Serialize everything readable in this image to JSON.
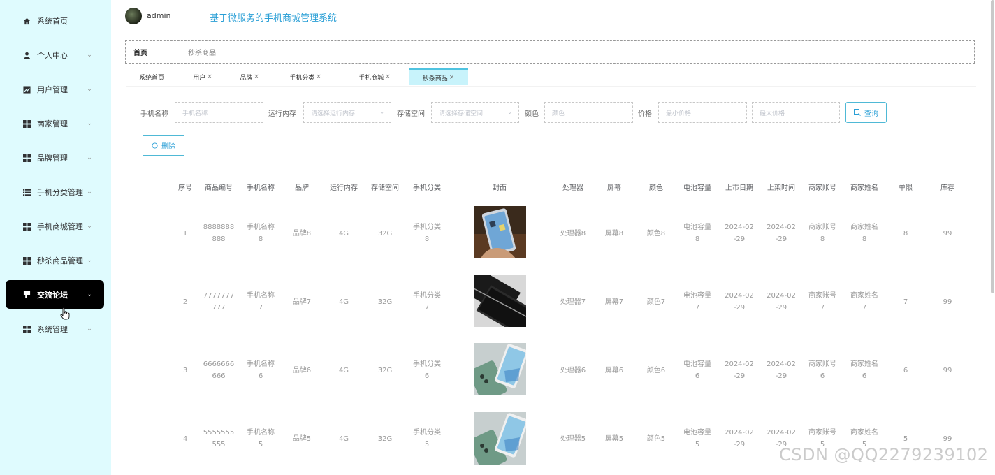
{
  "sidebar": {
    "items": [
      {
        "label": "系统首页",
        "icon": "home-icon",
        "has_children": false
      },
      {
        "label": "个人中心",
        "icon": "user-icon",
        "has_children": true
      },
      {
        "label": "用户管理",
        "icon": "chart-icon",
        "has_children": true
      },
      {
        "label": "商家管理",
        "icon": "grid-icon",
        "has_children": true
      },
      {
        "label": "品牌管理",
        "icon": "grid-icon",
        "has_children": true
      },
      {
        "label": "手机分类管理",
        "icon": "list-icon",
        "has_children": true
      },
      {
        "label": "手机商城管理",
        "icon": "grid-icon",
        "has_children": true
      },
      {
        "label": "秒杀商品管理",
        "icon": "grid-icon",
        "has_children": true
      },
      {
        "label": "交流论坛",
        "icon": "forum-icon",
        "has_children": true,
        "active": true
      },
      {
        "label": "系统管理",
        "icon": "grid-icon",
        "has_children": true
      }
    ]
  },
  "header": {
    "username": "admin",
    "system_title": "基于微服务的手机商城管理系统"
  },
  "breadcrumb": {
    "home": "首页",
    "current": "秒杀商品"
  },
  "tabs": [
    {
      "label": "系统首页",
      "closable": false
    },
    {
      "label": "用户",
      "closable": true
    },
    {
      "label": "品牌",
      "closable": true
    },
    {
      "label": "手机分类",
      "closable": true
    },
    {
      "label": "手机商城",
      "closable": true
    },
    {
      "label": "秒杀商品",
      "closable": true,
      "active": true
    }
  ],
  "search": {
    "name_label": "手机名称",
    "name_placeholder": "手机名称",
    "ram_label": "运行内存",
    "ram_placeholder": "请选择运行内存",
    "storage_label": "存储空间",
    "storage_placeholder": "请选择存储空间",
    "color_label": "颜色",
    "color_placeholder": "颜色",
    "price_label": "价格",
    "min_price_placeholder": "最小价格",
    "max_price_placeholder": "最大价格",
    "query_button": "查询",
    "delete_button": "删除"
  },
  "table": {
    "columns": [
      "序号",
      "商品编号",
      "手机名称",
      "品牌",
      "运行内存",
      "存储空间",
      "手机分类",
      "封面",
      "处理器",
      "屏幕",
      "颜色",
      "电池容量",
      "上市日期",
      "上架时间",
      "商家账号",
      "商家姓名",
      "单限",
      "库存"
    ],
    "rows": [
      {
        "index": "1",
        "code_a": "8888888",
        "code_b": "888",
        "name_a": "手机名称",
        "name_b": "8",
        "brand": "品牌8",
        "ram": "4G",
        "storage": "32G",
        "cat_a": "手机分类",
        "cat_b": "8",
        "cpu": "处理器8",
        "screen": "屏幕8",
        "color": "颜色8",
        "bat_a": "电池容量",
        "bat_b": "8",
        "date_a": "2024-02",
        "date_b": "-29",
        "time_a": "2024-02",
        "time_b": "-29",
        "acc_a": "商家账号",
        "acc_b": "8",
        "mname_a": "商家姓名",
        "mname_b": "8",
        "limit": "8",
        "stock": "99"
      },
      {
        "index": "2",
        "code_a": "7777777",
        "code_b": "777",
        "name_a": "手机名称",
        "name_b": "7",
        "brand": "品牌7",
        "ram": "4G",
        "storage": "32G",
        "cat_a": "手机分类",
        "cat_b": "7",
        "cpu": "处理器7",
        "screen": "屏幕7",
        "color": "颜色7",
        "bat_a": "电池容量",
        "bat_b": "7",
        "date_a": "2024-02",
        "date_b": "-29",
        "time_a": "2024-02",
        "time_b": "-29",
        "acc_a": "商家账号",
        "acc_b": "7",
        "mname_a": "商家姓名",
        "mname_b": "7",
        "limit": "7",
        "stock": "99"
      },
      {
        "index": "3",
        "code_a": "6666666",
        "code_b": "666",
        "name_a": "手机名称",
        "name_b": "6",
        "brand": "品牌6",
        "ram": "4G",
        "storage": "32G",
        "cat_a": "手机分类",
        "cat_b": "6",
        "cpu": "处理器6",
        "screen": "屏幕6",
        "color": "颜色6",
        "bat_a": "电池容量",
        "bat_b": "6",
        "date_a": "2024-02",
        "date_b": "-29",
        "time_a": "2024-02",
        "time_b": "-29",
        "acc_a": "商家账号",
        "acc_b": "6",
        "mname_a": "商家姓名",
        "mname_b": "6",
        "limit": "6",
        "stock": "99"
      },
      {
        "index": "4",
        "code_a": "5555555",
        "code_b": "555",
        "name_a": "手机名称",
        "name_b": "5",
        "brand": "品牌5",
        "ram": "4G",
        "storage": "32G",
        "cat_a": "手机分类",
        "cat_b": "5",
        "cpu": "处理器5",
        "screen": "屏幕5",
        "color": "颜色5",
        "bat_a": "电池容量",
        "bat_b": "5",
        "date_a": "2024-02",
        "date_b": "-29",
        "time_a": "2024-02",
        "time_b": "-29",
        "acc_a": "商家账号",
        "acc_b": "5",
        "mname_a": "商家姓名",
        "mname_b": "5",
        "limit": "5",
        "stock": "99"
      }
    ]
  },
  "watermark": "CSDN @QQ2279239102",
  "colors": {
    "sidebar_bg": "#dffbfe",
    "accent": "#2a9fd6",
    "active_tab": "#c8f3fb",
    "active_menu_bg": "#000000"
  }
}
